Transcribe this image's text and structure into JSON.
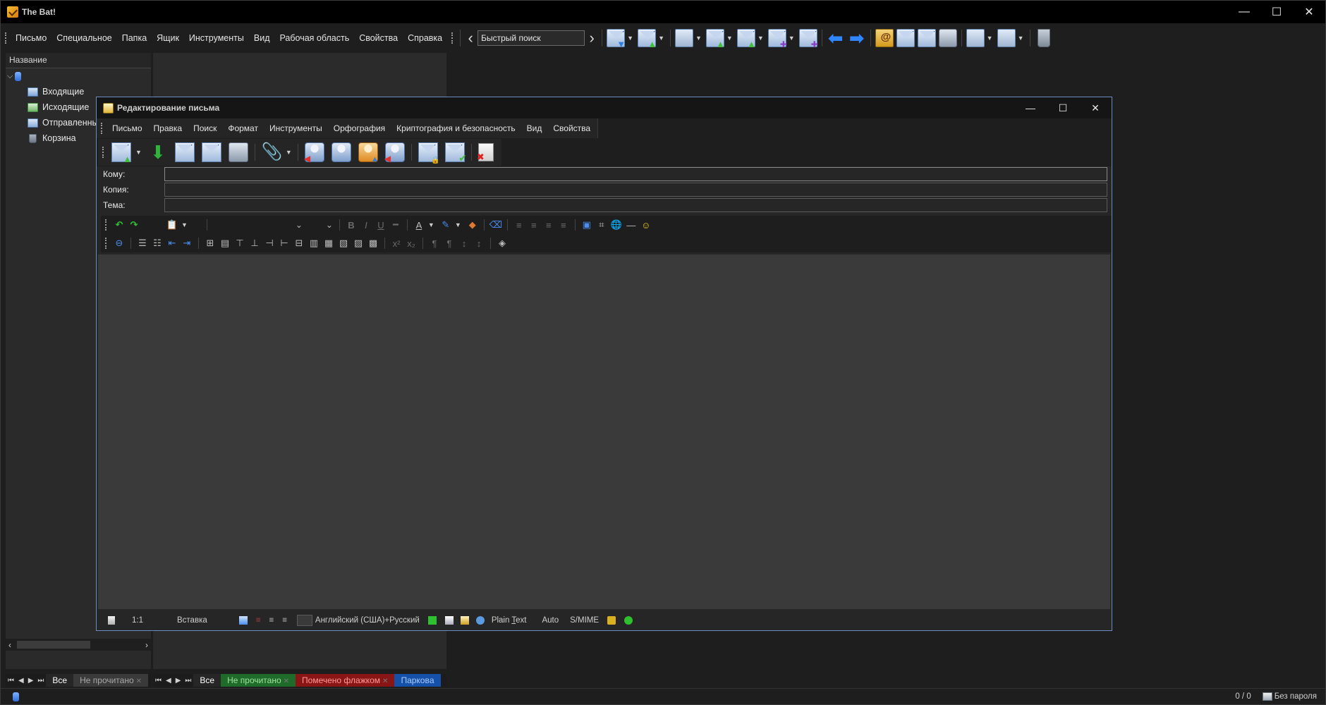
{
  "app": {
    "title": "The Bat!"
  },
  "window_controls": {
    "minimize": "—",
    "maximize": "☐",
    "close": "✕"
  },
  "main_menu": [
    "Письмо",
    "Специальное",
    "Папка",
    "Ящик",
    "Инструменты",
    "Вид",
    "Рабочая область",
    "Свойства",
    "Справка"
  ],
  "quick_search": {
    "value": "Быстрый поиск"
  },
  "folder_panel": {
    "header": "Название",
    "folders": [
      {
        "label": "Входящие",
        "icon": "inbox-icon"
      },
      {
        "label": "Исходящие",
        "icon": "outbox-icon"
      },
      {
        "label": "Отправленные",
        "icon": "sent-icon"
      },
      {
        "label": "Корзина",
        "icon": "trash-icon"
      }
    ]
  },
  "folder_tabs_left": {
    "all": "Все",
    "unread": "Не прочитано"
  },
  "folder_tabs_right": {
    "all": "Все",
    "unread": "Не прочитано",
    "flagged": "Помечено флажком",
    "parked": "Парковa"
  },
  "status": {
    "counts": "0 / 0",
    "password": "Без пароля"
  },
  "editor": {
    "title": "Редактирование письма",
    "menu": [
      "Письмо",
      "Правка",
      "Поиск",
      "Формат",
      "Инструменты",
      "Орфография",
      "Криптография и безопасность",
      "Вид",
      "Свойства"
    ],
    "fields": {
      "to_label": "Кому:",
      "to_value": "",
      "cc_label": "Копия:",
      "cc_value": "",
      "subject_label": "Тема:",
      "subject_value": ""
    },
    "status": {
      "position": "1:1",
      "mode": "Вставка",
      "language": "Английский (США)+Русский",
      "format_pre": "Plain ",
      "format_u": "T",
      "format_post": "ext",
      "charset": "Auto",
      "security": "S/MIME"
    }
  },
  "colors": {
    "accent_blue": "#2f86ff",
    "editor_border": "#6a8ec4",
    "flag_red": "#8a1515",
    "unread_green": "#1f6b2a"
  }
}
